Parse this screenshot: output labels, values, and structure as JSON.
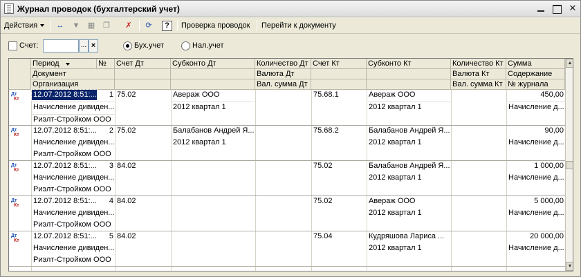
{
  "window": {
    "title": "Журнал проводок (бухгалтерский учет)"
  },
  "toolbar": {
    "actions_label": "Действия",
    "check_label": "Проверка проводок",
    "goto_label": "Перейти к документу",
    "help_label": "?"
  },
  "filter": {
    "account_label": "Счет:",
    "account_value": "",
    "pick_label": "...",
    "clear_label": "×",
    "radio_buh": "Бух.учет",
    "radio_nal": "Нал.учет",
    "selected": "Бух.учет"
  },
  "columns": {
    "period": "Период",
    "num": "№",
    "document": "Документ",
    "organization": "Организация",
    "acc_dt": "Счет Дт",
    "sub_dt": "Субконто Дт",
    "qty_dt": "Количество Дт",
    "cur_dt": "Валюта Дт",
    "cur_sum_dt": "Вал. сумма Дт",
    "acc_kt": "Счет Кт",
    "sub_kt": "Субконто Кт",
    "qty_kt": "Количество Кт",
    "cur_kt": "Валюта Кт",
    "cur_sum_kt": "Вал. сумма Кт",
    "sum": "Сумма",
    "content": "Содержание",
    "journal": "№ журнала"
  },
  "icon_text": {
    "dt": "Дт",
    "kt": "Кт"
  },
  "rows": [
    {
      "period": "12.07.2012 8:51:...",
      "num": "1",
      "document": "Начисление дивиден...",
      "organization": "Риэлт-Стройком ООО",
      "acc_dt": "75.02",
      "sub_dt_1": "Авераж ООО",
      "sub_dt_2": "2012 квартал 1",
      "acc_kt": "75.68.1",
      "sub_kt_1": "Авераж ООО",
      "sub_kt_2": "2012 квартал 1",
      "sum": "450,00",
      "content": "Начисление д..."
    },
    {
      "period": "12.07.2012 8:51:...",
      "num": "2",
      "document": "Начисление дивиден...",
      "organization": "Риэлт-Стройком ООО",
      "acc_dt": "75.02",
      "sub_dt_1": "Балабанов Андрей Я...",
      "sub_dt_2": "2012 квартал 1",
      "acc_kt": "75.68.2",
      "sub_kt_1": "Балабанов Андрей Я...",
      "sub_kt_2": "2012 квартал 1",
      "sum": "90,00",
      "content": "Начисление д..."
    },
    {
      "period": "12.07.2012 8:51:...",
      "num": "3",
      "document": "Начисление дивиден...",
      "organization": "Риэлт-Стройком ООО",
      "acc_dt": "84.02",
      "sub_dt_1": "",
      "sub_dt_2": "",
      "acc_kt": "75.02",
      "sub_kt_1": "Балабанов Андрей Я...",
      "sub_kt_2": "2012 квартал 1",
      "sum": "1 000,00",
      "content": "Начисление д..."
    },
    {
      "period": "12.07.2012 8:51:...",
      "num": "4",
      "document": "Начисление дивиден...",
      "organization": "Риэлт-Стройком ООО",
      "acc_dt": "84.02",
      "sub_dt_1": "",
      "sub_dt_2": "",
      "acc_kt": "75.02",
      "sub_kt_1": "Авераж ООО",
      "sub_kt_2": "2012 квартал 1",
      "sum": "5 000,00",
      "content": "Начисление д..."
    },
    {
      "period": "12.07.2012 8:51:...",
      "num": "5",
      "document": "Начисление дивиден...",
      "organization": "Риэлт-Стройком ООО",
      "acc_dt": "84.02",
      "sub_dt_1": "",
      "sub_dt_2": "",
      "acc_kt": "75.04",
      "sub_kt_1": "Кудряшова Лариса ...",
      "sub_kt_2": "2012 квартал 1",
      "sum": "20 000,00",
      "content": "Начисление д..."
    }
  ]
}
